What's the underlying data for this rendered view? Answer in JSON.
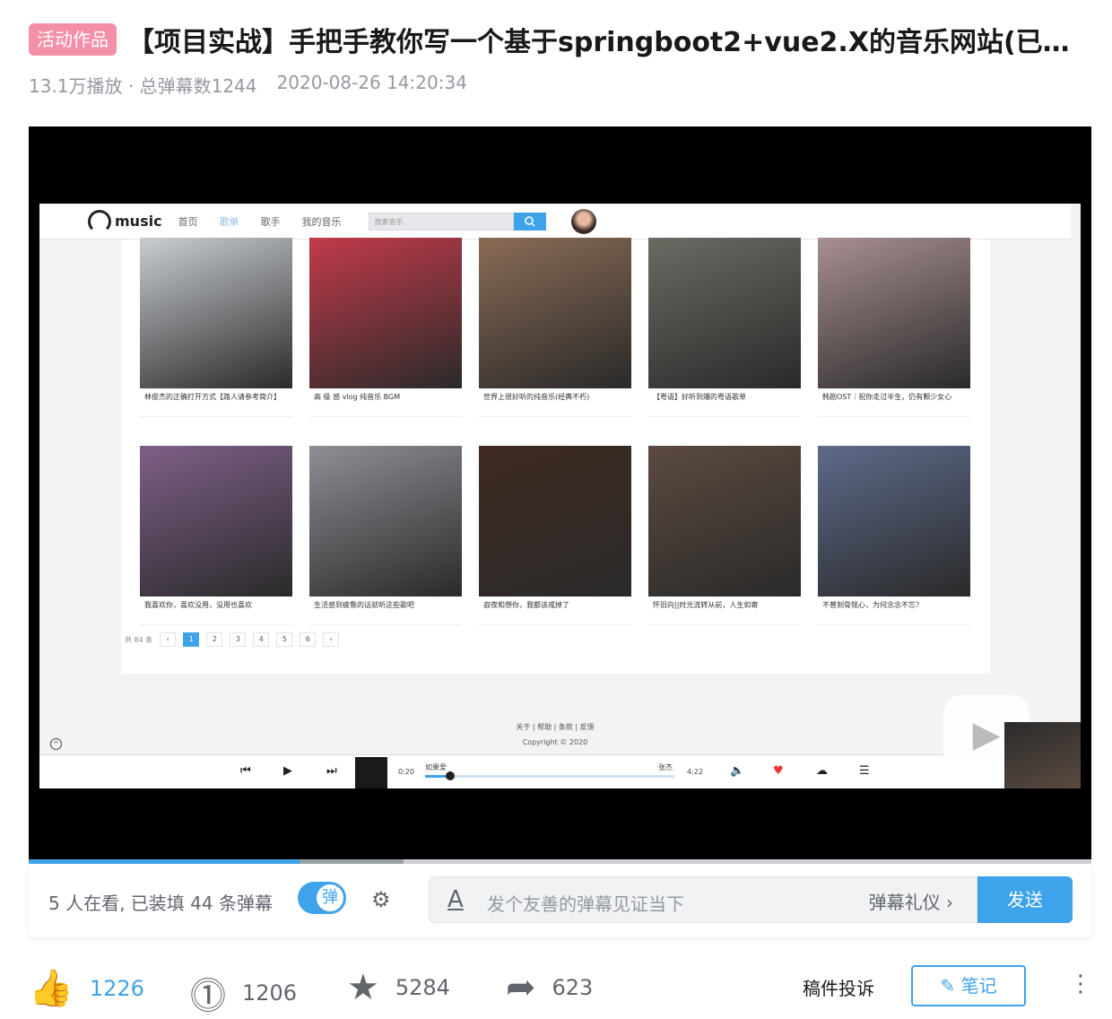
{
  "header": {
    "badge": "活动作品",
    "title": "【项目实战】手把手教你写一个基于springboot2+vue2.X的音乐网站(已完...",
    "stats": "13.1万播放 · 总弹幕数1244",
    "date": "2020-08-26 14:20:34"
  },
  "app": {
    "logo": "music",
    "nav": [
      "首页",
      "歌单",
      "歌手",
      "我的音乐"
    ],
    "active_nav": "歌单",
    "search_placeholder": "搜索音乐",
    "cards": [
      {
        "caption": "林俊杰的正确打开方式【路人请参考简介】",
        "color": "#c9cdd2"
      },
      {
        "caption": "高 级 感 vlog 纯音乐 BGM",
        "color": "#c23a4a"
      },
      {
        "caption": "世界上很好听的纯音乐(经典不朽)",
        "color": "#8a6b55"
      },
      {
        "caption": "【粤语】好听到爆的粤语歌单",
        "color": "#6b6a63"
      },
      {
        "caption": "韩剧OST｜祝你走过半生，仍有颗少女心",
        "color": "#a88f90"
      },
      {
        "caption": "我喜欢你，喜欢没用，没用也喜欢",
        "color": "#7e5f88"
      },
      {
        "caption": "生活感到疲惫的话就听这些歌吧",
        "color": "#8e8f95"
      },
      {
        "caption": "寂夜和想你，我都该戒掉了",
        "color": "#3f2a22"
      },
      {
        "caption": "怀旧向||时光流转从前，人生如寄",
        "color": "#5b4a3f"
      },
      {
        "caption": "不曾刻骨铭心，为何念念不忘？",
        "color": "#5e6a8a"
      }
    ],
    "pager": {
      "total": "共 84 条",
      "prev": "‹",
      "next": "›",
      "pages": [
        "1",
        "2",
        "3",
        "4",
        "5",
        "6"
      ],
      "current": "1"
    },
    "footer_links": "关于 | 帮助 | 条款 | 反馈",
    "copyright": "Copyright © 2020",
    "player": {
      "current_time": "0:20",
      "song": "如果爱",
      "artist": "张杰",
      "duration": "4:22",
      "progress": 0.1
    }
  },
  "video_progress": 0.255,
  "danmaku": {
    "viewers": "5 人在看, 已装填 44 条弹幕",
    "toggle_label": "弹",
    "placeholder": "发个友善的弹幕见证当下",
    "etiquette": "弹幕礼仪 ›",
    "send": "发送"
  },
  "actions": {
    "like": "1226",
    "coin": "1206",
    "favorite": "5284",
    "share": "623",
    "report": "稿件投诉",
    "note": "笔记"
  },
  "colors": {
    "accent": "#3ea3eb",
    "badge": "#f48fa8"
  }
}
